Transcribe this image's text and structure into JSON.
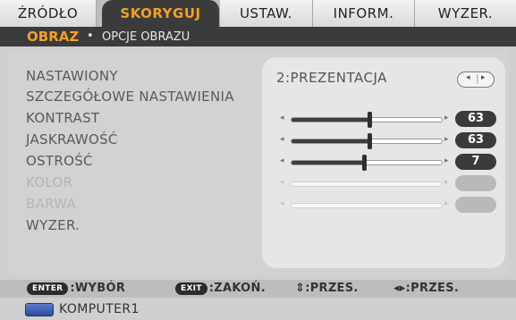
{
  "tabs": [
    {
      "label": "ŹRÓDŁO"
    },
    {
      "label": "SKORYGUJ"
    },
    {
      "label": "USTAW."
    },
    {
      "label": "INFORM."
    },
    {
      "label": "WYZER."
    }
  ],
  "active_tab_index": 1,
  "subtabs": {
    "active": "OBRAZ",
    "separator": "•",
    "other": "OPCJE OBRAZU"
  },
  "menu": {
    "items": [
      {
        "label": "NASTAWIONY",
        "enabled": true
      },
      {
        "label": "SZCZEGÓŁOWE NASTAWIENIA",
        "enabled": true
      },
      {
        "label": "KONTRAST",
        "enabled": true
      },
      {
        "label": "JASKRAWOŚĆ",
        "enabled": true
      },
      {
        "label": "OSTROŚĆ",
        "enabled": true
      },
      {
        "label": "KOLOR",
        "enabled": false
      },
      {
        "label": "BARWA",
        "enabled": false
      },
      {
        "label": "WYZER.",
        "enabled": true
      }
    ]
  },
  "preset": {
    "value": "2:PREZENTACJA",
    "left_arrow": "◂",
    "right_arrow": "▸"
  },
  "sliders": [
    {
      "label": "KONTRAST",
      "value": "63",
      "level": 0.52,
      "enabled": true
    },
    {
      "label": "JASKRAWOŚĆ",
      "value": "63",
      "level": 0.52,
      "enabled": true
    },
    {
      "label": "OSTROŚĆ",
      "value": "7",
      "level": 0.48,
      "enabled": true
    },
    {
      "label": "KOLOR",
      "value": "",
      "level": 0.0,
      "enabled": false
    },
    {
      "label": "BARWA",
      "value": "",
      "level": 0.0,
      "enabled": false
    }
  ],
  "slider_arrows": {
    "left": "◂",
    "right": "▸"
  },
  "help": {
    "enter_key": "ENTER",
    "enter_text": ":WYBÓR",
    "exit_key": "EXIT",
    "exit_text": ":ZAKOŃ.",
    "updown_text": "⇕:PRZES.",
    "leftright_text": "◂▸:PRZES."
  },
  "source": {
    "icon": "computer-input-icon",
    "label": "KOMPUTER1"
  },
  "colors": {
    "accent": "#f2a125",
    "active_tab_bg": "#3b3b3b",
    "badge": "#3a3a3a"
  }
}
